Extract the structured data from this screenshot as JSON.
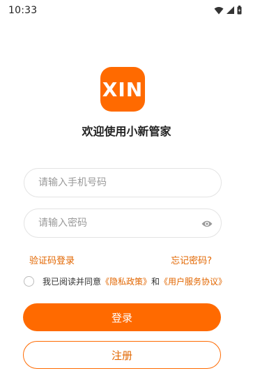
{
  "status": {
    "time": "10:33"
  },
  "app": {
    "logo_text": "XIN",
    "title": "欢迎使用小新管家"
  },
  "phone": {
    "placeholder": "请输入手机号码",
    "value": ""
  },
  "password": {
    "placeholder": "请输入密码",
    "value": ""
  },
  "links": {
    "code_login": "验证码登录",
    "forgot_password": "忘记密码?"
  },
  "agreement": {
    "prefix": "我已阅读并同意",
    "privacy": "《隐私政策》",
    "and": "和",
    "user_agreement": "《用户服务协议》"
  },
  "buttons": {
    "login": "登录",
    "register": "注册"
  },
  "colors": {
    "accent": "#ff6a00",
    "link": "#e26600"
  },
  "icons": {
    "wifi": "wifi-icon",
    "signal": "signal-icon",
    "battery": "battery-icon",
    "eye": "eye-icon"
  }
}
